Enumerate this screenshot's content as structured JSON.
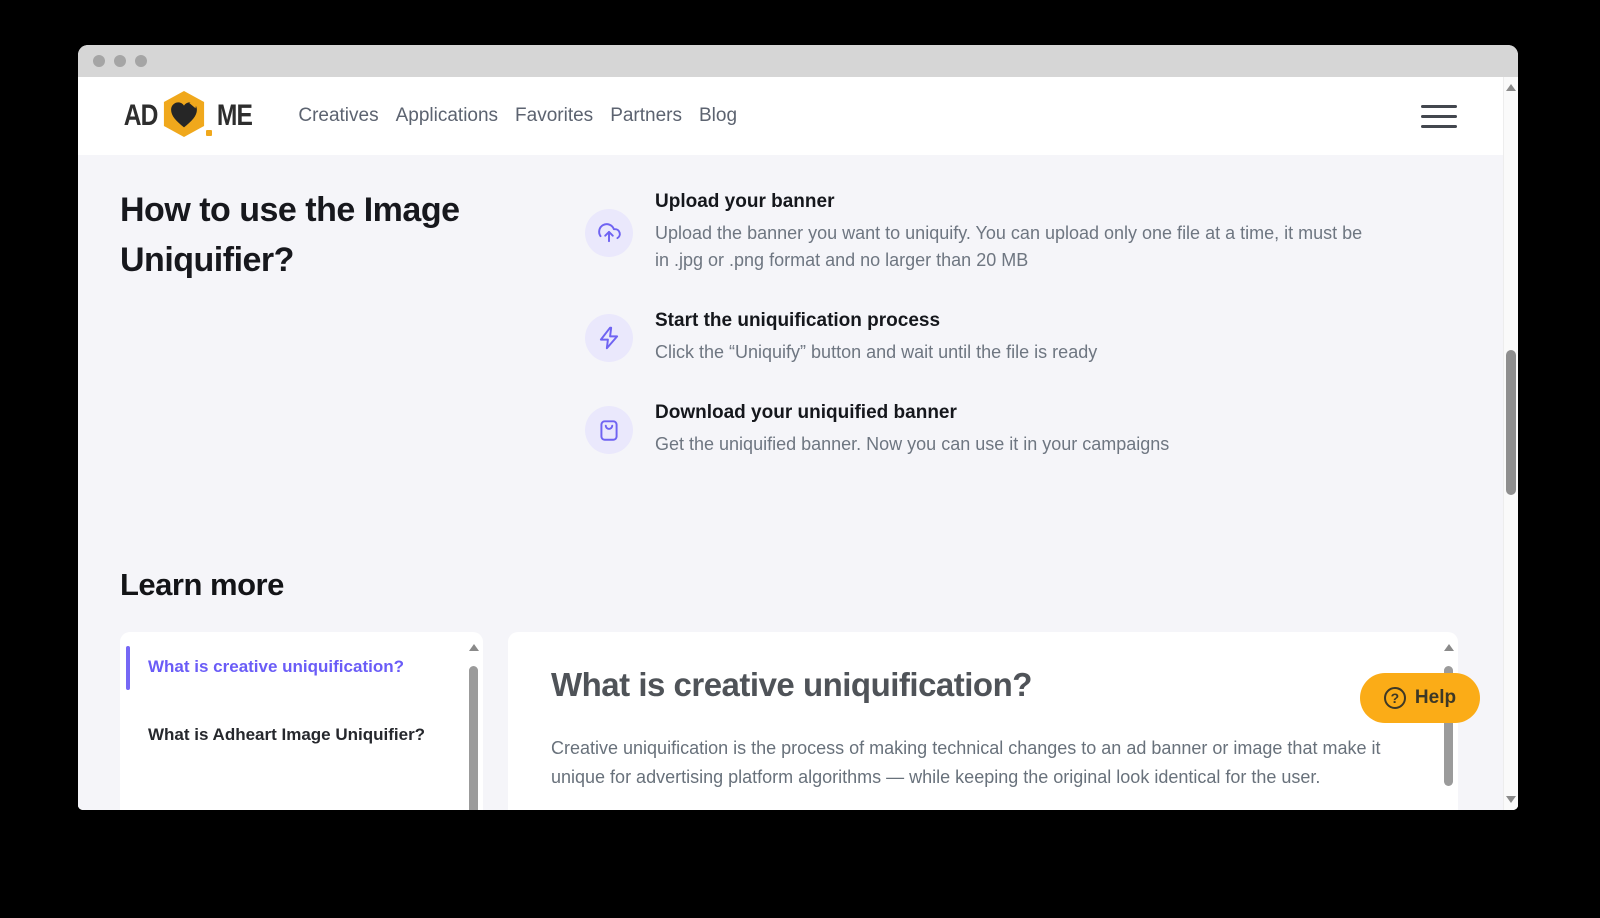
{
  "window": {
    "titlebar_dots": 3
  },
  "header": {
    "logo": {
      "prefix": "AD",
      "suffix": "ME",
      "icon": "heart-hexagon-icon"
    },
    "nav": [
      {
        "label": "Creatives"
      },
      {
        "label": "Applications"
      },
      {
        "label": "Favorites"
      },
      {
        "label": "Partners"
      },
      {
        "label": "Blog"
      }
    ]
  },
  "hero": {
    "title": "How to use the Image Uniquifier?",
    "steps": [
      {
        "icon": "cloud-upload-icon",
        "title": "Upload your banner",
        "description": "Upload the banner you want to uniquify. You can upload only one file at a time, it must be in .jpg or .png format and no larger than 20 MB"
      },
      {
        "icon": "lightning-icon",
        "title": "Start the uniquification process",
        "description": "Click the “Uniquify” button and wait until the file is ready"
      },
      {
        "icon": "bag-icon",
        "title": "Download your uniquified banner",
        "description": "Get the uniquified banner. Now you can use it in your campaigns"
      }
    ]
  },
  "learn_more": {
    "title": "Learn more",
    "topics": [
      {
        "label": "What is creative uniquification?",
        "active": true
      },
      {
        "label": "What is Adheart Image Uniquifier?",
        "active": false
      }
    ],
    "article": {
      "title": "What is creative uniquification?",
      "body": "Creative uniquification is the process of making technical changes to an ad banner or image that make it unique for advertising platform algorithms — while keeping the original look identical for the user."
    }
  },
  "help_button": {
    "label": "Help",
    "icon": "question-circle-icon"
  },
  "colors": {
    "accent_purple": "#6f63f2",
    "purple_bg": "#eae8fc",
    "accent_yellow": "#fbac17",
    "page_bg": "#f5f5f9",
    "active_topic": "#6a5cf7"
  }
}
